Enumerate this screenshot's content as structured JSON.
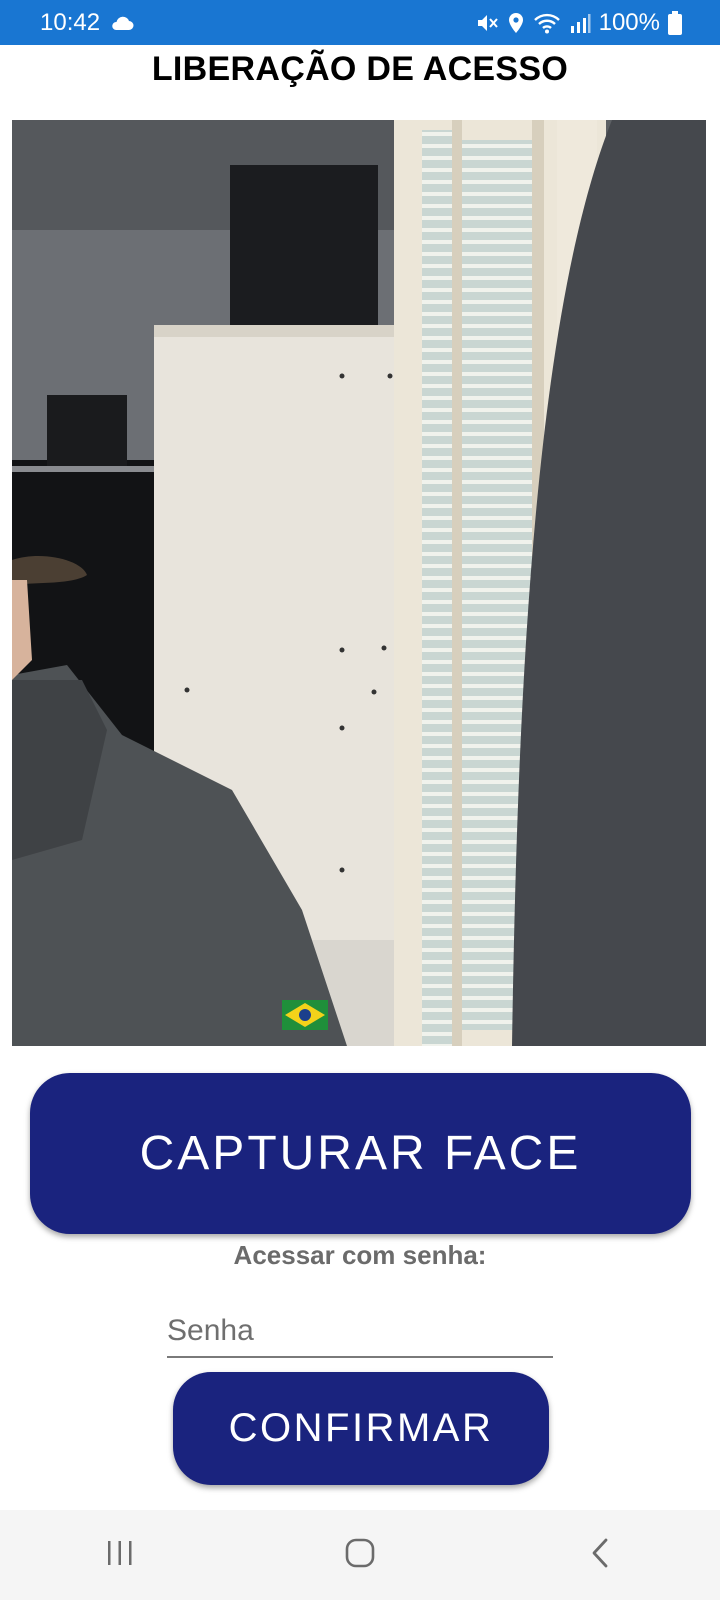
{
  "status_bar": {
    "time": "10:42",
    "battery": "100%",
    "icons": [
      "cloud-icon",
      "mute-vibrate-icon",
      "location-icon",
      "wifi-icon",
      "signal-icon",
      "battery-icon"
    ],
    "background": "#1976d2"
  },
  "page": {
    "title": "LIBERAÇÃO DE ACESSO"
  },
  "camera": {
    "description_icon": "camera-preview"
  },
  "actions": {
    "capture_label": "CAPTURAR FACE",
    "password_prompt": "Acessar com senha:",
    "password_placeholder": "Senha",
    "password_value": "",
    "confirm_label": "CONFIRMAR"
  },
  "colors": {
    "primary_button": "#1a237e",
    "status_bar": "#1976d2",
    "label_gray": "#6b6b6b"
  },
  "nav_bar": {
    "icons": [
      "recent-apps-icon",
      "home-icon",
      "back-icon"
    ]
  }
}
